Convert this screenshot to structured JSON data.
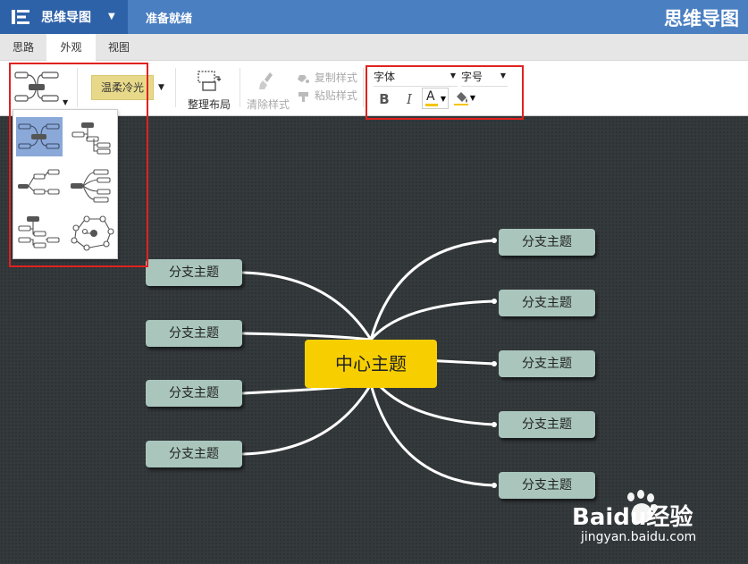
{
  "header": {
    "app_name": "思维导图",
    "status": "准备就绪",
    "title": "思维导图"
  },
  "tabs": [
    {
      "label": "思路",
      "active": false
    },
    {
      "label": "外观",
      "active": true
    },
    {
      "label": "视图",
      "active": false
    }
  ],
  "toolbar": {
    "theme_label": "温柔冷光",
    "layout_label": "整理布局",
    "clear_style_label": "清除样式",
    "copy_style_label": "复制样式",
    "paste_style_label": "粘贴样式",
    "font_placeholder": "字体",
    "size_placeholder": "字号",
    "bold_label": "B",
    "italic_label": "I",
    "font_color_label": "A"
  },
  "colors": {
    "header": "#4a7fc1",
    "header_dark": "#2e62a8",
    "canvas": "#34393c",
    "center_node": "#f7cf00",
    "branch_node": "#a9c5bc",
    "theme_button": "#e8d98a",
    "highlight": "#e0221f",
    "font_color_bar": "#f5c400"
  },
  "mindmap": {
    "center": "中心主题",
    "left_branches": [
      "分支主题",
      "分支主题",
      "分支主题",
      "分支主题"
    ],
    "right_branches": [
      "分支主题",
      "分支主题",
      "分支主题",
      "分支主题",
      "分支主题"
    ]
  },
  "watermark": {
    "brand": "Baidu经验",
    "url": "jingyan.baidu.com"
  }
}
